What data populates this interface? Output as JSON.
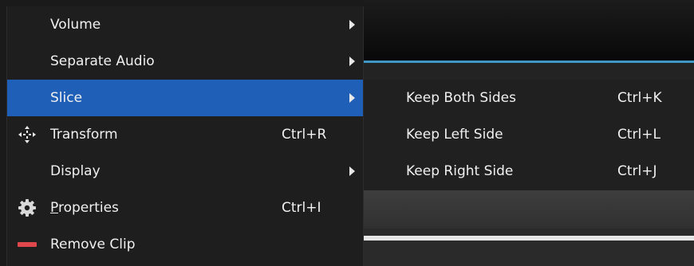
{
  "menu": {
    "items": [
      {
        "label": "Volume",
        "shortcut": "",
        "has_submenu": true
      },
      {
        "label": "Separate Audio",
        "shortcut": "",
        "has_submenu": true
      },
      {
        "label": "Slice",
        "shortcut": "",
        "has_submenu": true,
        "highlighted": true
      },
      {
        "label": "Transform",
        "shortcut": "Ctrl+R",
        "icon": "move-arrows-icon"
      },
      {
        "label": "Display",
        "shortcut": "",
        "has_submenu": true
      },
      {
        "label_underlined": "P",
        "label_rest": "roperties",
        "shortcut": "Ctrl+I",
        "icon": "gear-icon"
      },
      {
        "label": "Remove Clip",
        "shortcut": "",
        "icon": "remove-bar-icon"
      }
    ]
  },
  "submenu": {
    "items": [
      {
        "label": "Keep Both Sides",
        "shortcut": "Ctrl+K"
      },
      {
        "label": "Keep Left Side",
        "shortcut": "Ctrl+L"
      },
      {
        "label": "Keep Right Side",
        "shortcut": "Ctrl+J"
      }
    ]
  },
  "colors": {
    "highlight": "#1f5fb8",
    "menu_bg": "#1e1e1e",
    "accent_line": "#3f97c6",
    "remove_icon": "#e0474c"
  }
}
